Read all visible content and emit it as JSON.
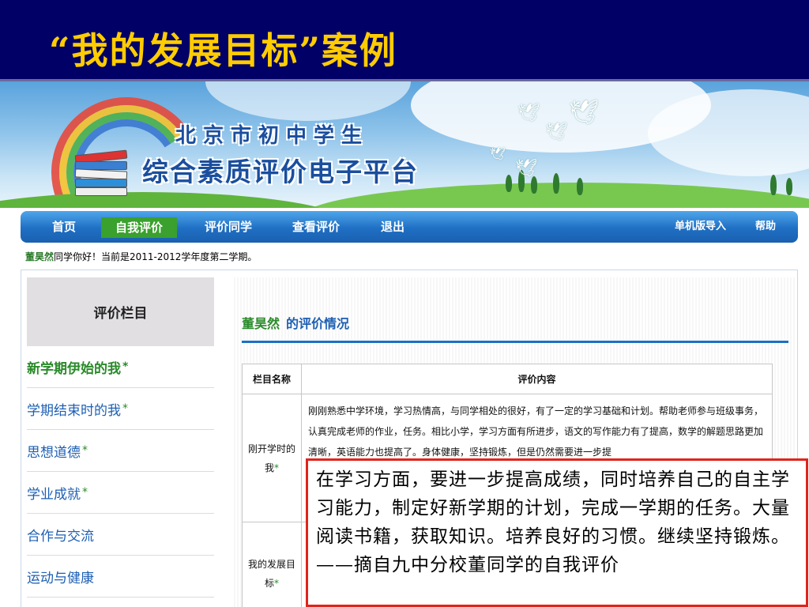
{
  "slide": {
    "title": "“我的发展目标”案例"
  },
  "banner": {
    "line1": "北京市初中学生",
    "line2": "综合素质评价电子平台"
  },
  "nav": {
    "items": [
      "首页",
      "自我评价",
      "评价同学",
      "查看评价",
      "退出"
    ],
    "active_index": 1,
    "right_items": [
      "单机版导入",
      "帮助"
    ]
  },
  "greeting": {
    "name": "董昊然",
    "text": "同学你好！当前是2011-2012学年度第二学期。"
  },
  "sidebar": {
    "header": "评价栏目",
    "items": [
      {
        "label": "新学期伊始的我",
        "star": "*"
      },
      {
        "label": "学期结束时的我",
        "star": "*"
      },
      {
        "label": "思想道德",
        "star": "*"
      },
      {
        "label": "学业成就",
        "star": "*"
      },
      {
        "label": "合作与交流",
        "star": ""
      },
      {
        "label": "运动与健康",
        "star": ""
      }
    ]
  },
  "content": {
    "student_name": "董昊然",
    "title_suffix": "的评价情况",
    "table": {
      "headers": [
        "栏目名称",
        "评价内容"
      ],
      "rows": [
        {
          "name": "刚开学时的我",
          "star": "*",
          "text": "刚刚熟悉中学环境，学习热情高，与同学相处的很好，有了一定的学习基础和计划。帮助老师参与班级事务，认真完成老师的作业，任务。相比小学，学习方面有所进步，语文的写作能力有了提高，数学的解题思路更加清晰，英语能力也提高了。身体健康，坚持锻炼，但是仍然需要进一步提"
        },
        {
          "name": "我的发展目标",
          "star": "*",
          "text": ""
        }
      ]
    }
  },
  "callout": {
    "text": "在学习方面，要进一步提高成绩，同时培养自己的自主学习能力，制定好新学期的计划，完成一学期的任务。大量阅读书籍，获取知识。培养良好的习惯。继续坚持锻炼。——摘自九中分校董同学的自我评价"
  },
  "colors": {
    "slide_bg": "#000066",
    "slide_title": "#FFCC00",
    "nav_blue": "#1f6fc4",
    "nav_active": "#3aa02e",
    "link_blue": "#1d5fb3",
    "green": "#2a8a2a",
    "callout_border": "#e0241b"
  }
}
